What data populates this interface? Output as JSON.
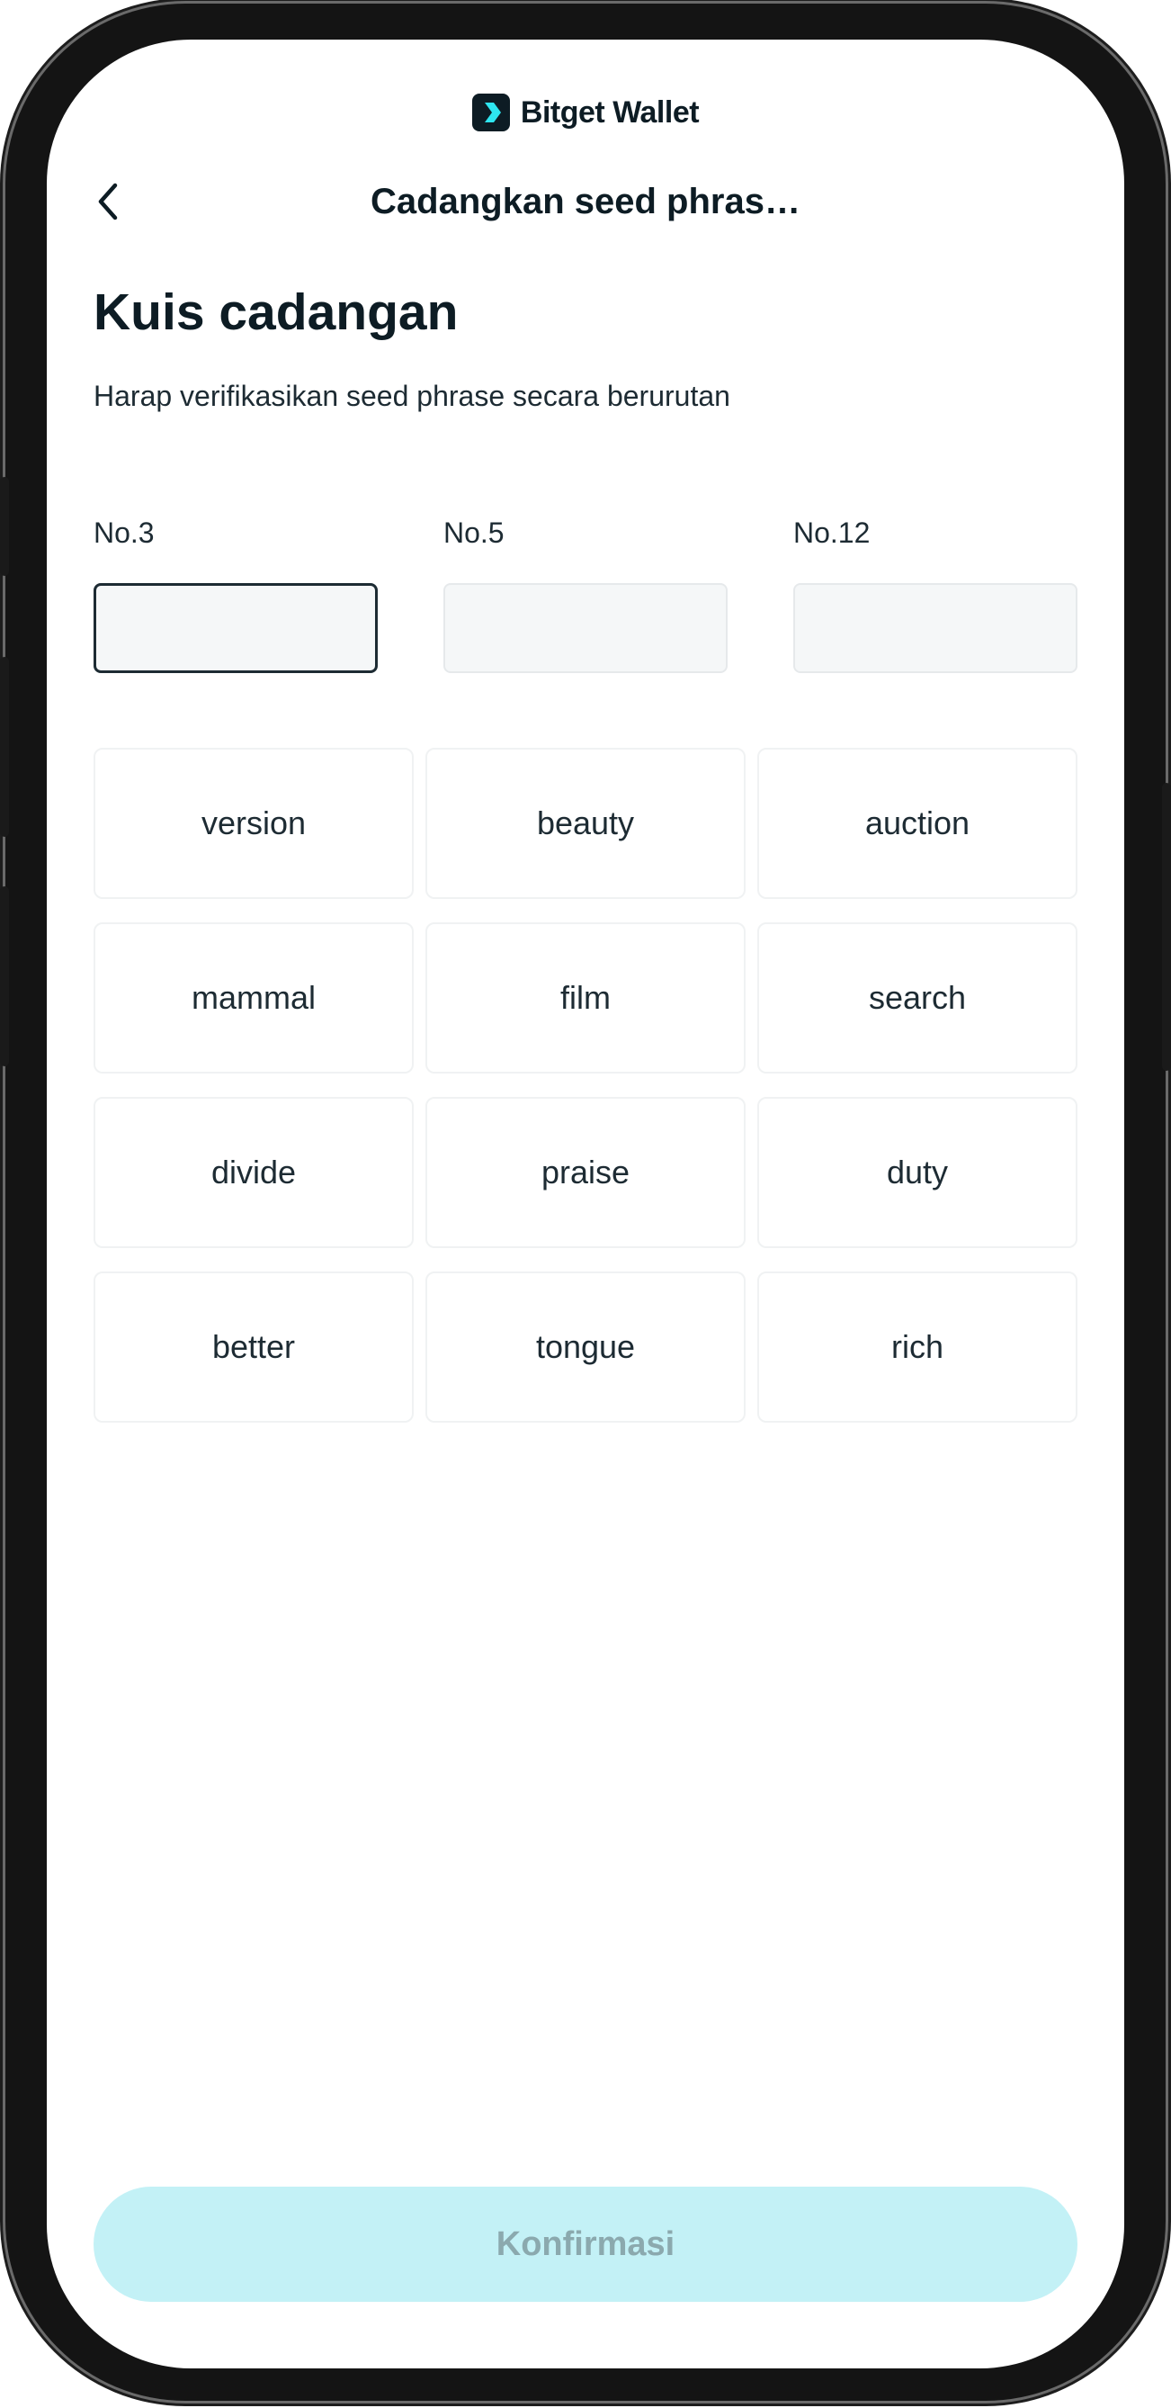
{
  "brand": {
    "name": "Bitget Wallet",
    "logo_icon": "bitget-chevron-icon"
  },
  "header": {
    "title": "Cadangkan seed phras…",
    "back_icon": "chevron-left-icon"
  },
  "quiz": {
    "title": "Kuis cadangan",
    "subtitle": "Harap verifikasikan seed phrase secara berurutan",
    "slots": [
      {
        "label": "No.3",
        "value": ""
      },
      {
        "label": "No.5",
        "value": ""
      },
      {
        "label": "No.12",
        "value": ""
      }
    ],
    "words": [
      "version",
      "beauty",
      "auction",
      "mammal",
      "film",
      "search",
      "divide",
      "praise",
      "duty",
      "better",
      "tongue",
      "rich"
    ]
  },
  "confirm_label": "Konfirmasi",
  "colors": {
    "primary_text": "#0d1c24",
    "button_disabled_bg": "#c3f1f6",
    "button_disabled_text": "#8ba9ae"
  }
}
